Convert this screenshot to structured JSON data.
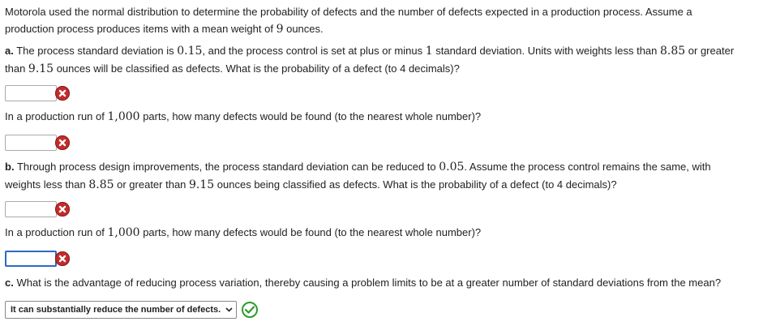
{
  "intro": {
    "line1": "Motorola used the normal distribution to determine the probability of defects and the number of defects expected in a production process. Assume a",
    "line2_pre": "production process produces items with a mean weight of ",
    "line2_num": "9",
    "line2_post": " ounces."
  },
  "part_a": {
    "label": "a.",
    "l1_t1": " The process standard deviation is ",
    "l1_n1": "0.15",
    "l1_t2": ", and the process control is set at plus or minus ",
    "l1_n2": "1",
    "l1_t3": " standard deviation. Units with weights less than ",
    "l1_n3": "8.85",
    "l1_t4": " or greater",
    "l2_t1": "than ",
    "l2_n1": "9.15",
    "l2_t2": " ounces will be classified as defects. What is the probability of a defect (to 4 decimals)?",
    "q2_pre": "In a production run of ",
    "q2_num": "1,000",
    "q2_post": " parts, how many defects would be found (to the nearest whole number)?"
  },
  "part_b": {
    "label": "b.",
    "l1_t1": " Through process design improvements, the process standard deviation can be reduced to ",
    "l1_n1": "0.05",
    "l1_t2": ". Assume the process control remains the same, with",
    "l2_t1": "weights less than ",
    "l2_n1": "8.85",
    "l2_t2": " or greater than ",
    "l2_n2": "9.15",
    "l2_t3": " ounces being classified as defects. What is the probability of a defect (to 4 decimals)?",
    "q2_pre": "In a production run of ",
    "q2_num": "1,000",
    "q2_post": " parts, how many defects would be found (to the nearest whole number)?"
  },
  "part_c": {
    "label": "c.",
    "text": " What is the advantage of reducing process variation, thereby causing a problem limits to be at a greater number of standard deviations from the mean?",
    "selected": "It can substantially reduce the number of defects."
  },
  "answers": {
    "a1": "",
    "a2": "",
    "b1": "",
    "b2": ""
  },
  "icons": {
    "incorrect": "incorrect-x-icon",
    "correct": "correct-check-icon",
    "incorrect_color": "#c22c2c",
    "correct_color": "#2e9a2e"
  }
}
